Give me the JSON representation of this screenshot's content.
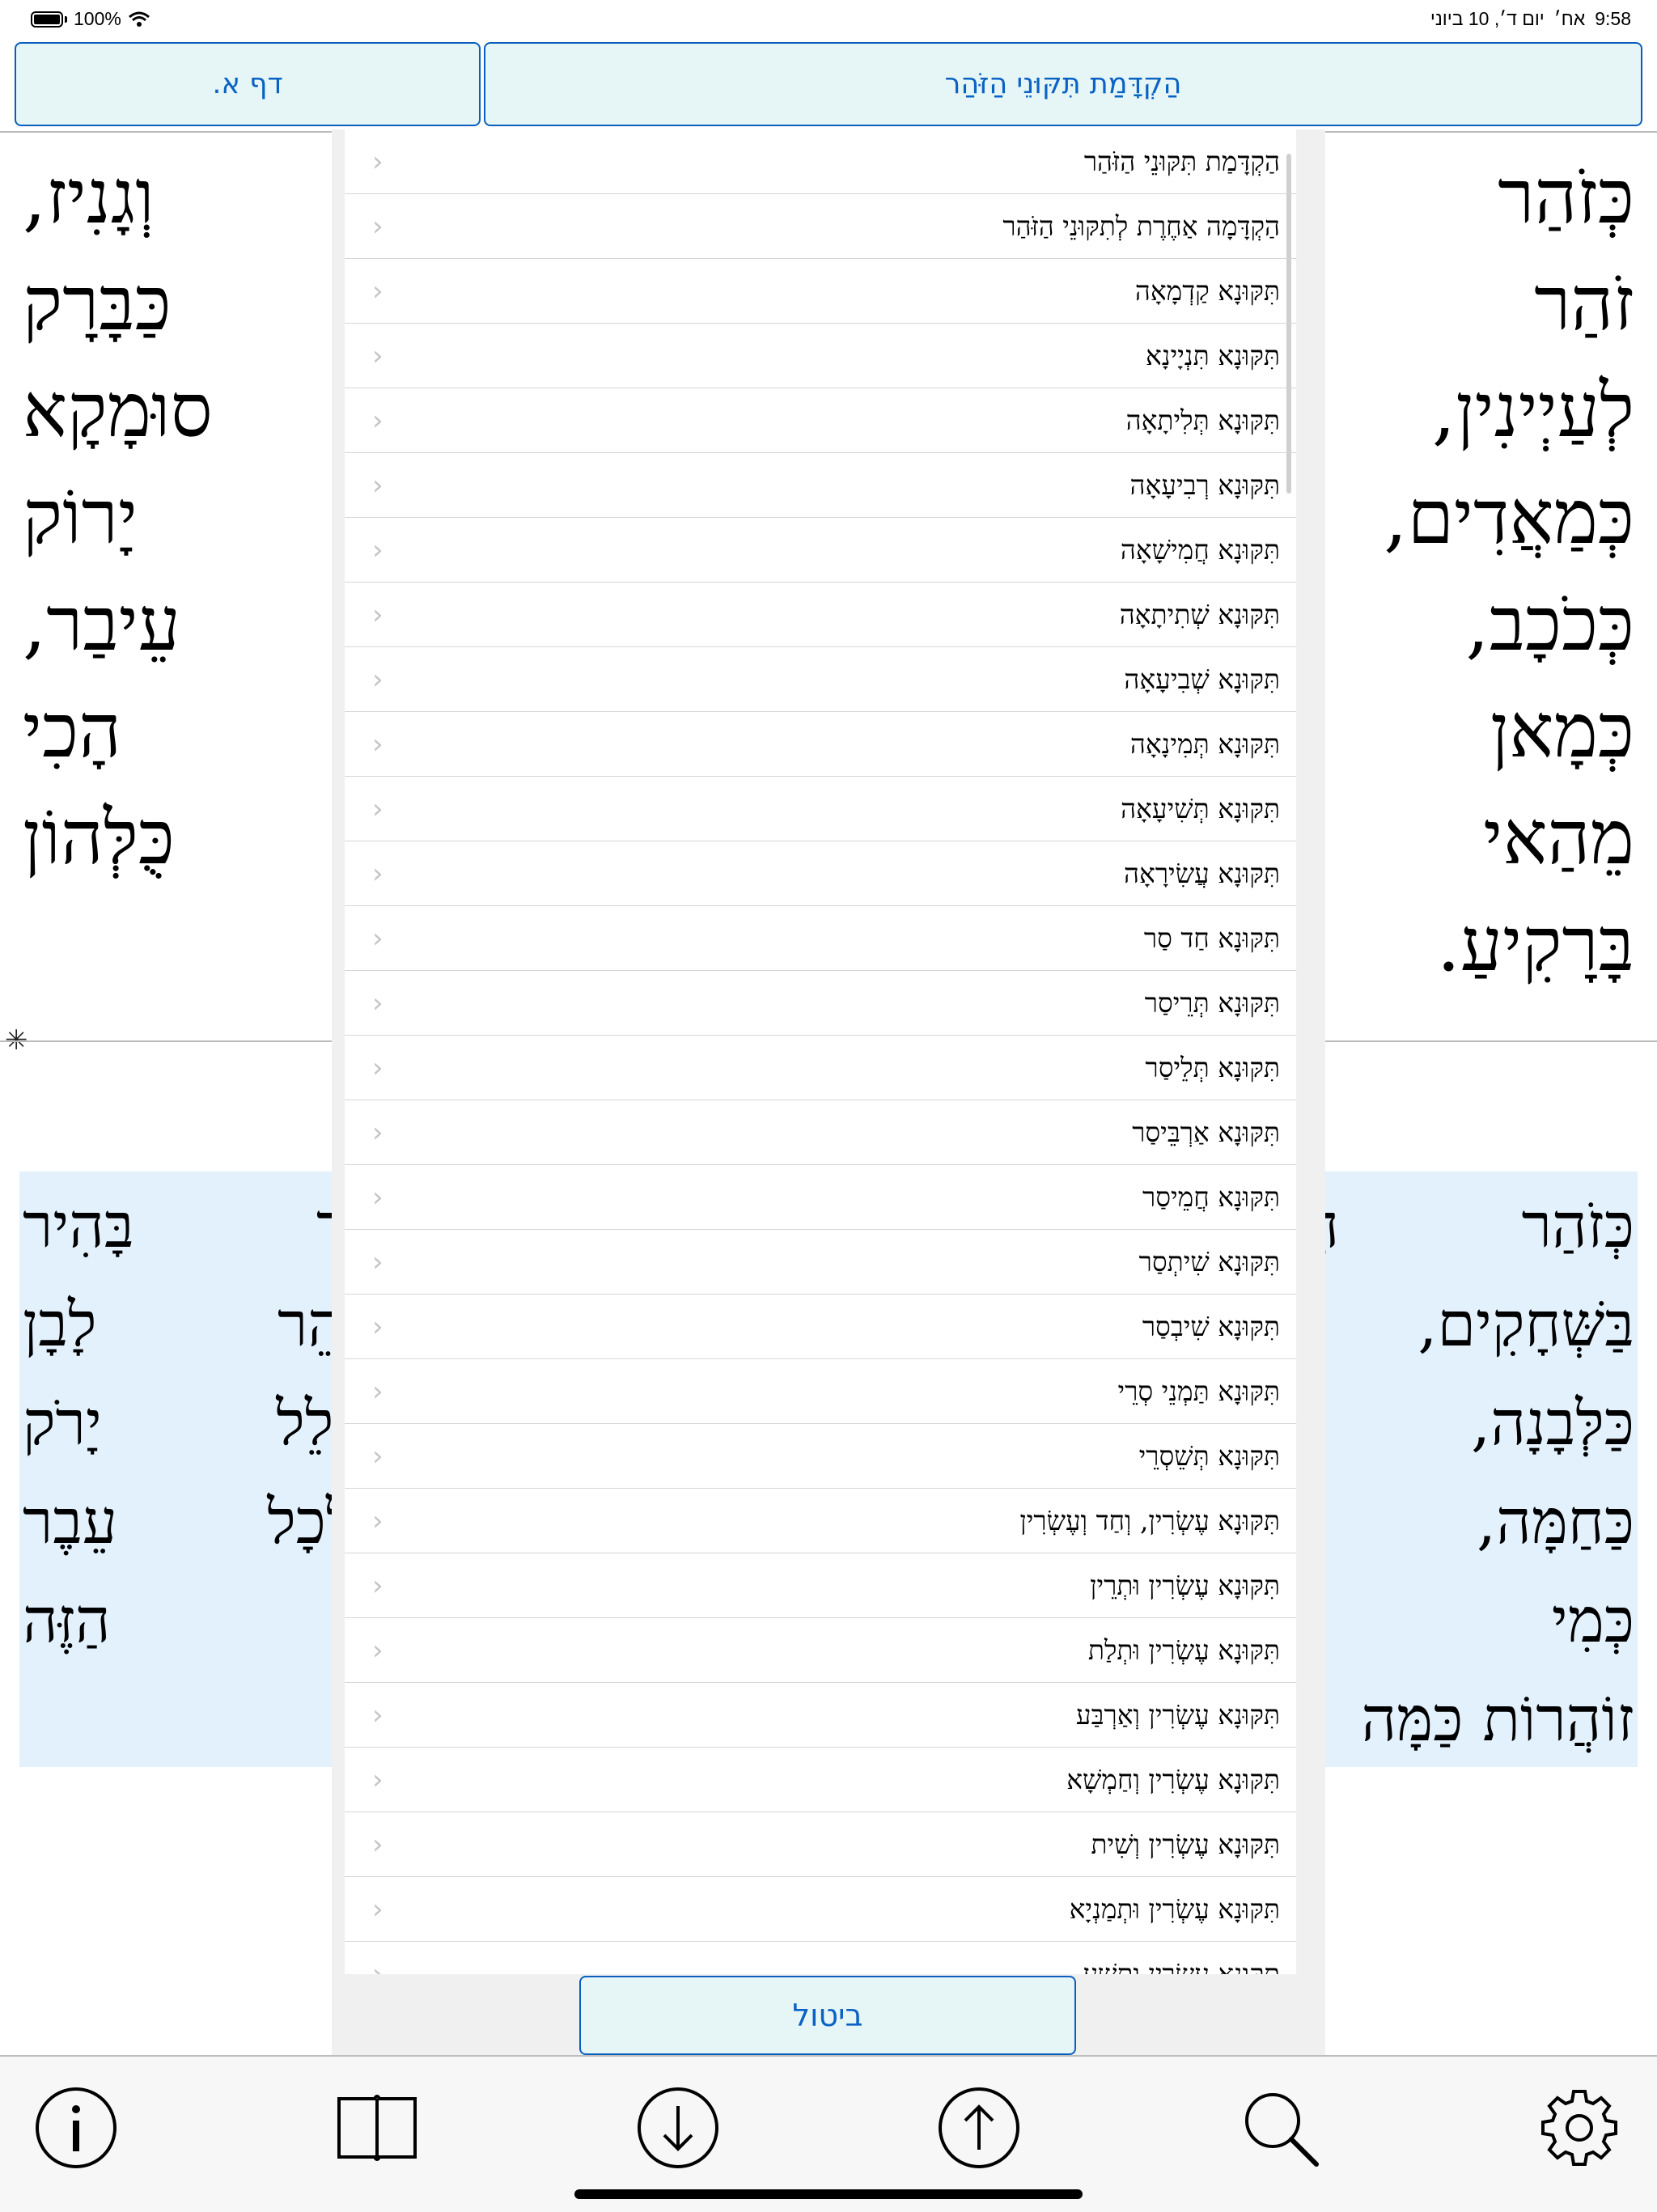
{
  "status_bar": {
    "battery": "100%",
    "time": "9:58",
    "ampm": "אח׳",
    "date": "יום ד׳, 10 ביוני"
  },
  "header": {
    "page_button": "דף א.",
    "section_button": "הַקְדָּמַת תִּקּוּנֵי הַזֹּהַר"
  },
  "top_pane": {
    "lines": [
      "כְּזֹהַר הָרָקִיעַ מַזְהִירִים שׁוֹמִיר וְגָנִיז,",
      "זֹהַר בָּהִיר מְלַהֵט וּמַבְרִיק כַּבָּרָק",
      "לְעַיְינִין, זֹהַר חִוָּר זֹהַר סוּמָקָא",
      "כְּמַאֲדִים, זֹהַר יַרְקָא זֹהַר יָרוֹק",
      "כְּכֹכָב, זֹהַר כָּלִיל דְּכָלִיל לְכָל עֵיבַר,",
      "כְּמָאן דְּמַזְהִיר מִגּוֹ סִטְרָא, הָכִי",
      "מֵהַאי זֹהַר אִתְזְהַרִין כֻּלְּהוֹן",
      "בָּרָקִיעַ."
    ]
  },
  "bottom_pane": {
    "lines": [
      "כְּזֹהַר הָרָקִיעַ מַזְהִיר וְגָנוּז, זֹהַר בָּהִיר",
      "בַּשְּׁחָקִים, זוֹהַר מְלַהֵט זֹהַר זוֹהֵר לָבָן",
      "כַּלְּבָנָה, זֹהַר אָדֹם כְּמַאְדִּים, כּוֹלֵל יָרֹק",
      "כַּחַמָּה, זֹהַר כָּלִיל כּוֹלֵל זֹהַר לְכָל עֵבֶר",
      "כְּמִי שֶׁמַּכֶּה מִבִּפְנִים מֵהַזֹּהַר הַזֶּה",
      "זוֹהֲרוֹת כַּמָּה"
    ]
  },
  "menu": {
    "items": [
      "הַקְדָּמַת תִּקּוּנֵי הַזֹּהַר",
      "הַקְדָּמָה אַחֶרֶת לְתִקּוּנֵי הַזֹּהַר",
      "תִּקּוּנָא קַדְמָאָה",
      "תִּקּוּנָא תִּנְיָינָא",
      "תִּקּוּנָא תְּלִיתָאָה",
      "תִּקּוּנָא רְבִיעָאָה",
      "תִּקּוּנָא חֲמִישָׁאָה",
      "תִּקּוּנָא שְׁתִיתָאָה",
      "תִּקּוּנָא שְׁבִיעָאָה",
      "תִּקּוּנָא תְּמִינָאָה",
      "תִּקּוּנָא תְּשִׁיעָאָה",
      "תִּקּוּנָא עֲשִׂירָאָה",
      "תִּקּוּנָא חַד סַר",
      "תִּקּוּנָא תְּרֵיסַר",
      "תִּקּוּנָא תְּלֵיסַר",
      "תִּקּוּנָא אַרְבֵּיסַר",
      "תִּקּוּנָא חֲמֵיסַר",
      "תִּקּוּנָא שִׁיתְסַר",
      "תִּקּוּנָא שִׁיבְסַר",
      "תִּקּוּנָא תַּמְנֵי סְרֵי",
      "תִּקּוּנָא תְּשֵׁסְרֵי",
      "תִּקּוּנָא עֶשְׂרִין, וְחַד וְעֶשְׂרִין",
      "תִּקּוּנָא עֶשְׂרִין וּתְרֵין",
      "תִּקּוּנָא עֶשְׂרִין וּתְלַת",
      "תִּקּוּנָא עֶשְׂרִין וְאַרְבַּע",
      "תִּקּוּנָא עֶשְׂרִין וְחַמְשָׁא",
      "תִּקּוּנָא עֶשְׂרִין וְשִׁית",
      "תִּקּוּנָא עֶשְׂרִין וּתְמַנְיָא",
      "תִּקּוּנָא עֶשְׂרִין וּתְשַׁע"
    ],
    "chevron": "‹",
    "cancel_label": "ביטול"
  },
  "toolbar": {
    "icons": [
      "info-icon",
      "book-icon",
      "arrow-down-circle-icon",
      "arrow-up-circle-icon",
      "search-icon",
      "gear-icon"
    ]
  },
  "colors": {
    "accent": "#0a62c4",
    "button_bg": "#e6f6f6",
    "highlight_bg": "#e3f1fd"
  }
}
